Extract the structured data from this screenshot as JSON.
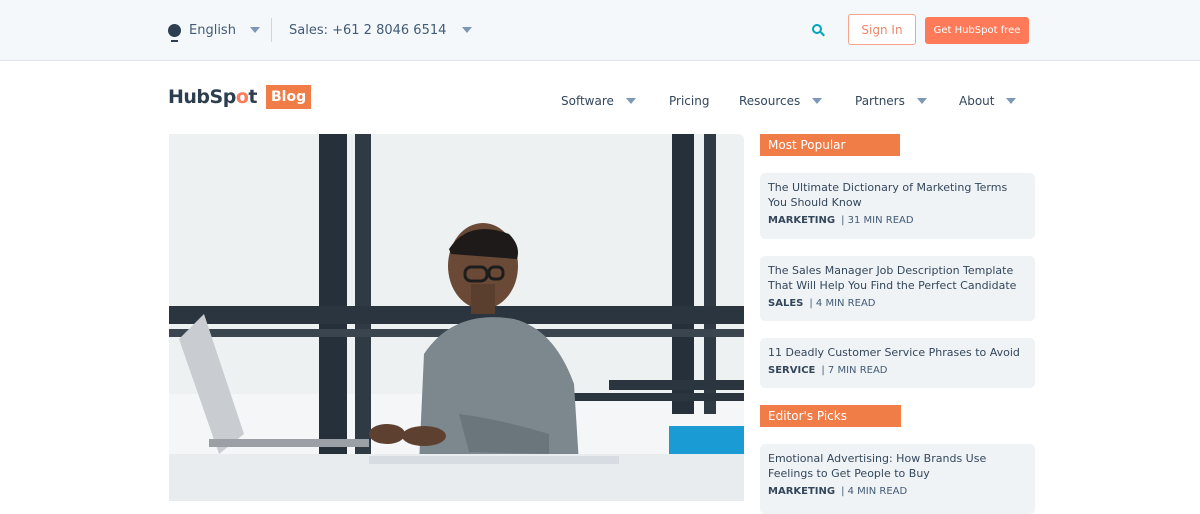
{
  "utility_bar": {
    "language": "English",
    "sales_phone": "Sales: +61 2 8046 6514",
    "sign_in": "Sign In",
    "get_free": "Get HubSpot free"
  },
  "header": {
    "logo_text_1": "HubSp",
    "logo_text_o": "o",
    "logo_text_2": "t",
    "blog_badge": "Blog",
    "nav": [
      {
        "label": "Software",
        "dropdown": true
      },
      {
        "label": "Pricing",
        "dropdown": false
      },
      {
        "label": "Resources",
        "dropdown": true
      },
      {
        "label": "Partners",
        "dropdown": true
      },
      {
        "label": "About",
        "dropdown": true
      }
    ]
  },
  "hero": {
    "image_description": "Man with glasses working on a laptop by a window"
  },
  "sidebar": {
    "most_popular": {
      "heading": "Most Popular",
      "articles": [
        {
          "title": "The Ultimate Dictionary of Marketing Terms You Should Know",
          "category": "MARKETING",
          "read_time": "| 31 MIN READ"
        },
        {
          "title": "The Sales Manager Job Description Template That Will Help You Find the Perfect Candidate",
          "category": "SALES",
          "read_time": "| 4 MIN READ"
        },
        {
          "title": "11 Deadly Customer Service Phrases to Avoid",
          "category": "SERVICE",
          "read_time": "| 7 MIN READ"
        }
      ]
    },
    "editors_picks": {
      "heading": "Editor's Picks",
      "articles": [
        {
          "title": "Emotional Advertising: How Brands Use Feelings to Get People to Buy",
          "category": "MARKETING",
          "read_time": "| 4 MIN READ"
        }
      ]
    }
  },
  "colors": {
    "brand_orange": "#ff7a59",
    "section_orange": "#f07c48",
    "accent_teal": "#00a4bd",
    "text_dark": "#33475b"
  }
}
